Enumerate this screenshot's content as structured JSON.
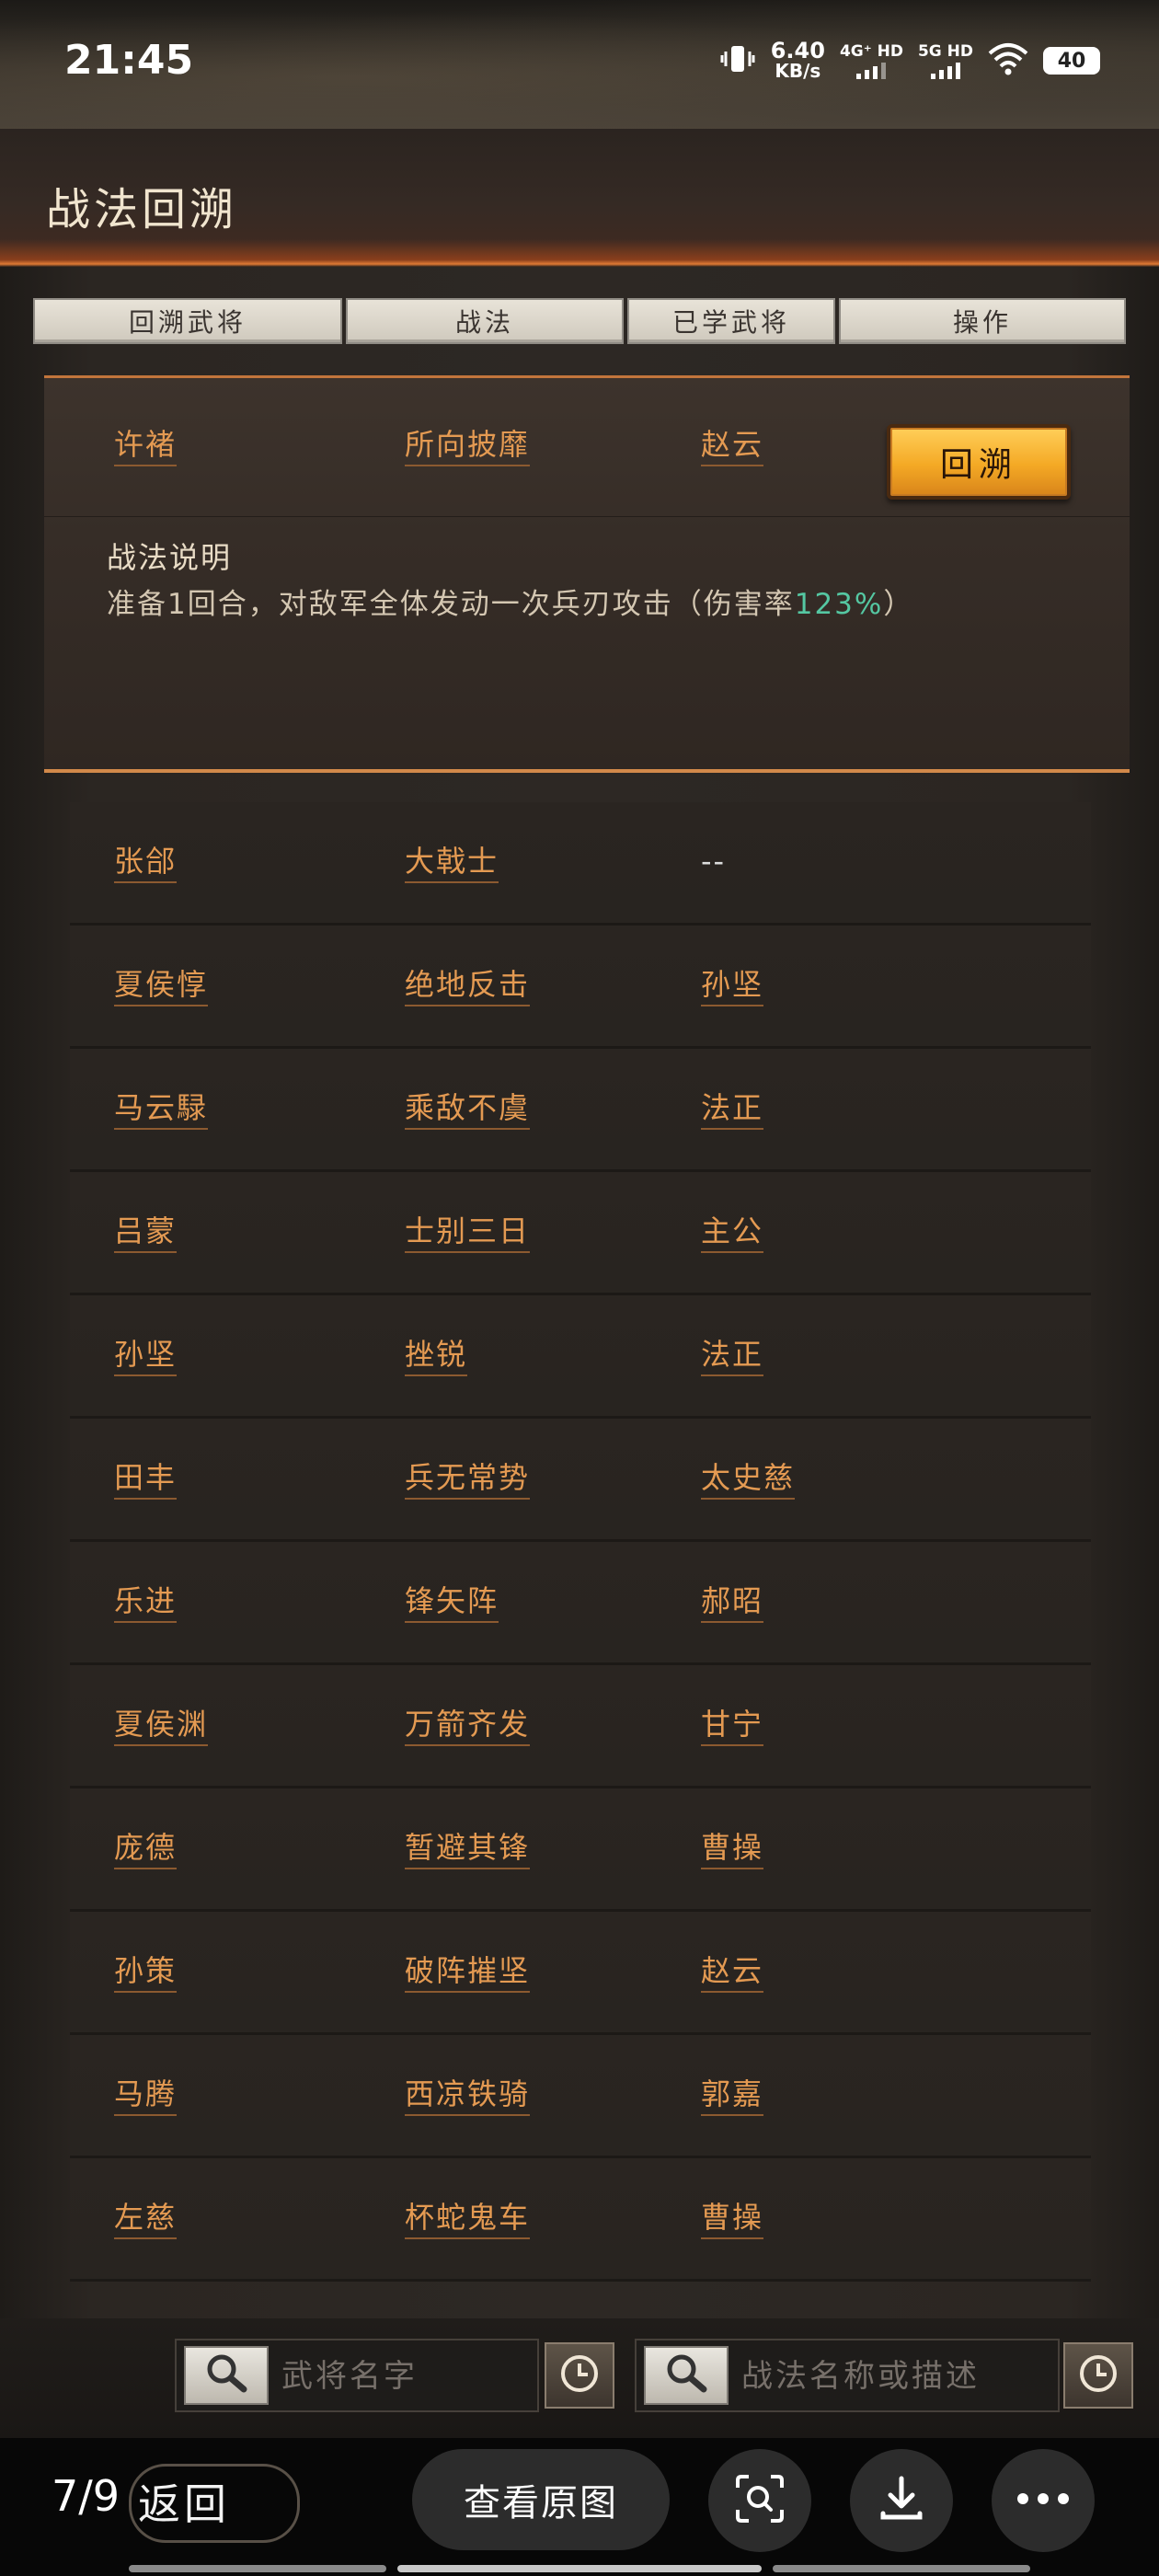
{
  "status_bar": {
    "time": "21:45",
    "speed_value": "6.40",
    "speed_unit": "KB/s",
    "net1": "4G⁺ HD",
    "net2": "5G HD",
    "battery": "40"
  },
  "title": "战法回溯",
  "tabs": [
    "回溯武将",
    "战法",
    "已学武将",
    "操作"
  ],
  "selected": {
    "general": "许褚",
    "tactic": "所向披靡",
    "learned": "赵云",
    "action_label": "回溯"
  },
  "description": {
    "title": "战法说明",
    "text_before": "准备1回合，对敌军全体发动一次兵刃攻击（伤害率",
    "highlight": "123%",
    "text_after": "）"
  },
  "rows": [
    {
      "general": "张郃",
      "tactic": "大戟士",
      "learned": "--"
    },
    {
      "general": "夏侯惇",
      "tactic": "绝地反击",
      "learned": "孙坚"
    },
    {
      "general": "马云騄",
      "tactic": "乘敌不虞",
      "learned": "法正"
    },
    {
      "general": "吕蒙",
      "tactic": "士别三日",
      "learned": "主公"
    },
    {
      "general": "孙坚",
      "tactic": "挫锐",
      "learned": "法正"
    },
    {
      "general": "田丰",
      "tactic": "兵无常势",
      "learned": "太史慈"
    },
    {
      "general": "乐进",
      "tactic": "锋矢阵",
      "learned": "郝昭"
    },
    {
      "general": "夏侯渊",
      "tactic": "万箭齐发",
      "learned": "甘宁"
    },
    {
      "general": "庞德",
      "tactic": "暂避其锋",
      "learned": "曹操"
    },
    {
      "general": "孙策",
      "tactic": "破阵摧坚",
      "learned": "赵云"
    },
    {
      "general": "马腾",
      "tactic": "西凉铁骑",
      "learned": "郭嘉"
    },
    {
      "general": "左慈",
      "tactic": "杯蛇鬼车",
      "learned": "曹操"
    }
  ],
  "search": {
    "general_placeholder": "武将名字",
    "tactic_placeholder": "战法名称或描述"
  },
  "viewer": {
    "counter": "7/9",
    "back_label": "返回",
    "view_original": "查看原图"
  },
  "colors": {
    "accent_orange": "#e49a52",
    "highlight_green": "#55c7a2",
    "button_gold": "#f4a925"
  }
}
